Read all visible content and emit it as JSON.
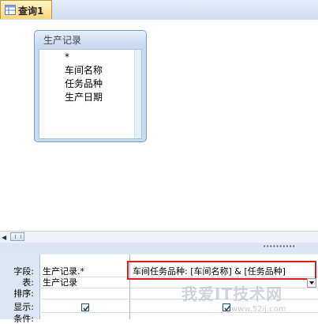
{
  "tab": {
    "label": "查询1",
    "icon": "query-icon"
  },
  "table": {
    "title": "生产记录",
    "fields": [
      "*",
      "车间名称",
      "任务品种",
      "生产日期"
    ]
  },
  "grid": {
    "row_labels": [
      "字段:",
      "表:",
      "排序:",
      "显示:",
      "条件:"
    ],
    "columns": [
      {
        "field": "生产记录.*",
        "table": "生产记录",
        "show": true
      },
      {
        "field": "车间任务品种: [车间名称] & [任务品种]",
        "table": "",
        "show": true
      }
    ]
  },
  "watermark": {
    "text": "我爱IT技术网",
    "sub": "www.52ij.com"
  },
  "colors": {
    "highlight": "#e01b1b",
    "tab": "#ffd57a",
    "grid_bg": "#dde7f4"
  }
}
